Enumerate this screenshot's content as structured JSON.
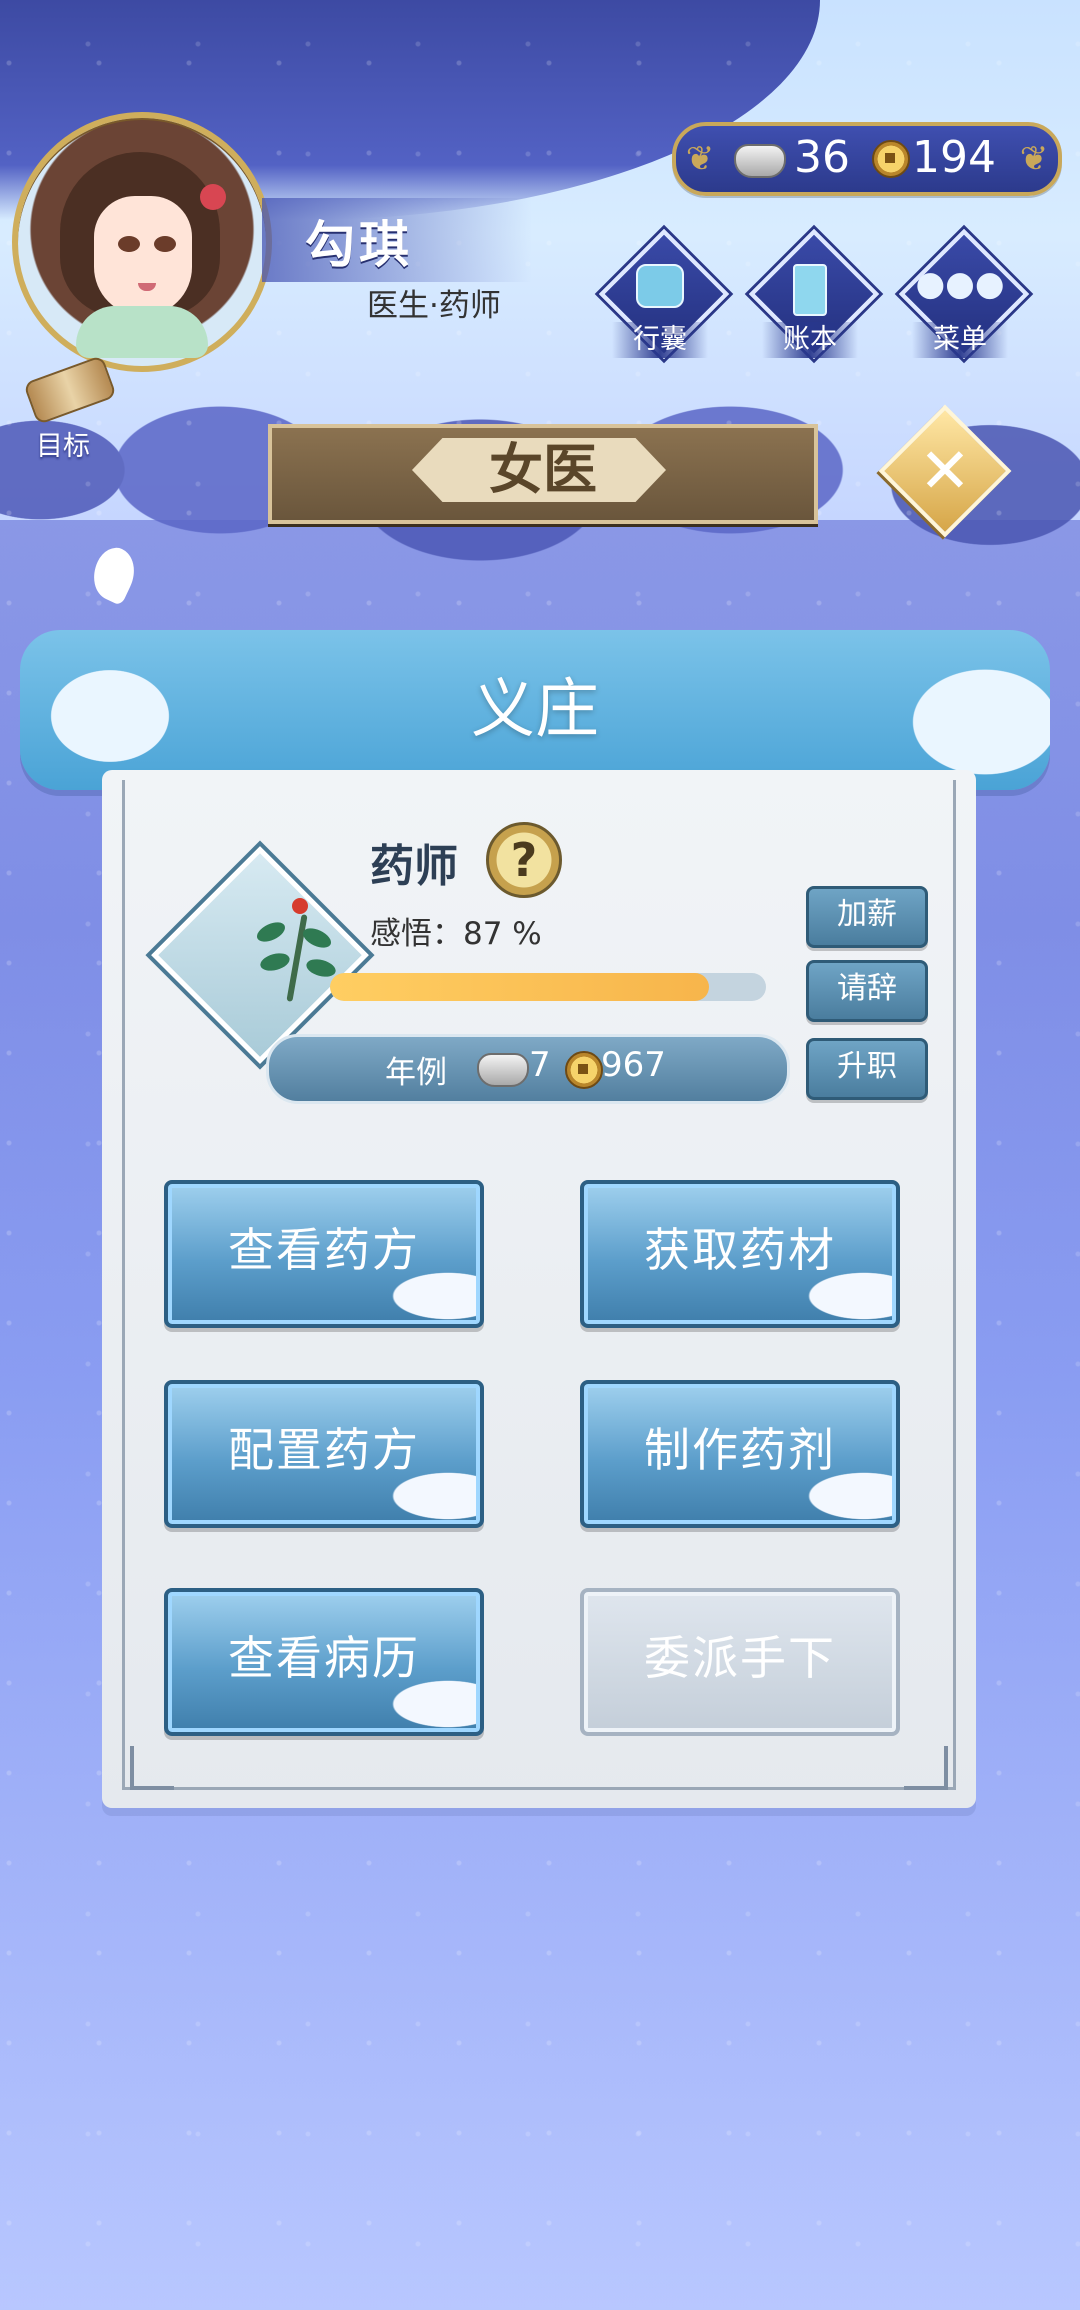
{
  "header": {
    "player_name": "勾琪",
    "player_role": "医生·药师",
    "currency": {
      "silver": "36",
      "gold": "194"
    },
    "top_buttons": [
      {
        "label": "行囊",
        "icon": "bag-icon"
      },
      {
        "label": "账本",
        "icon": "ledger-icon"
      },
      {
        "label": "菜单",
        "icon": "menu-dots-icon"
      }
    ],
    "target_label": "目标"
  },
  "title_banner": "女医",
  "section_title": "义庄",
  "job": {
    "title": "药师",
    "help_symbol": "?",
    "insight_label": "感悟：87 %",
    "progress_percent": 87,
    "salary_label": "年例",
    "salary_silver": "7",
    "salary_gold": "967"
  },
  "side_buttons": {
    "raise": "加薪",
    "resign": "请辞",
    "promote": "升职"
  },
  "actions": [
    {
      "label": "查看药方",
      "enabled": true
    },
    {
      "label": "获取药材",
      "enabled": true
    },
    {
      "label": "配置药方",
      "enabled": true
    },
    {
      "label": "制作药剂",
      "enabled": true
    },
    {
      "label": "查看病历",
      "enabled": true
    },
    {
      "label": "委派手下",
      "enabled": false
    }
  ],
  "close_symbol": "✕"
}
